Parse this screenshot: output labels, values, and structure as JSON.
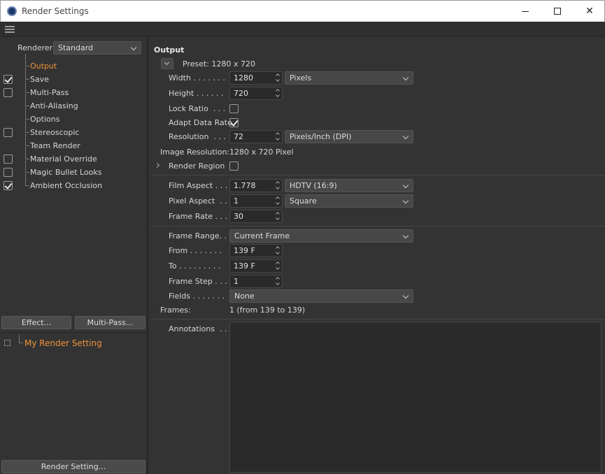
{
  "window": {
    "title": "Render Settings",
    "minimize": "—",
    "close": "✕"
  },
  "left": {
    "renderer_label": "Renderer",
    "renderer_value": "Standard",
    "items": [
      {
        "label": "Output",
        "checkbox": false,
        "checked": false,
        "active": true
      },
      {
        "label": "Save",
        "checkbox": true,
        "checked": true,
        "active": false
      },
      {
        "label": "Multi-Pass",
        "checkbox": true,
        "checked": false,
        "active": false
      },
      {
        "label": "Anti-Aliasing",
        "checkbox": false,
        "checked": false,
        "active": false
      },
      {
        "label": "Options",
        "checkbox": false,
        "checked": false,
        "active": false
      },
      {
        "label": "Stereoscopic",
        "checkbox": true,
        "checked": false,
        "active": false
      },
      {
        "label": "Team Render",
        "checkbox": false,
        "checked": false,
        "active": false
      },
      {
        "label": "Material Override",
        "checkbox": true,
        "checked": false,
        "active": false
      },
      {
        "label": "Magic Bullet Looks",
        "checkbox": true,
        "checked": false,
        "active": false
      },
      {
        "label": "Ambient Occlusion",
        "checkbox": true,
        "checked": true,
        "active": false
      }
    ],
    "effect_button": "Effect...",
    "multipass_button": "Multi-Pass...",
    "render_setting_name": "My Render Setting",
    "render_setting_button": "Render Setting..."
  },
  "output": {
    "section_title": "Output",
    "preset": "Preset: 1280 x 720",
    "width_label": "Width . . . . . . .",
    "width_value": "1280",
    "width_unit": "Pixels",
    "height_label": "Height . . . . . .",
    "height_value": "720",
    "lock_ratio_label": "Lock Ratio  . . .",
    "lock_ratio_checked": false,
    "adapt_label": "Adapt Data Rate",
    "adapt_checked": true,
    "resolution_label": "Resolution  . . .",
    "resolution_value": "72",
    "resolution_unit": "Pixels/Inch (DPI)",
    "image_resolution_label": "Image Resolution:",
    "image_resolution_value": "1280 x 720 Pixel",
    "render_region_label": "Render Region",
    "render_region_checked": false,
    "film_aspect_label": "Film Aspect . . .",
    "film_aspect_value": "1.778",
    "film_aspect_preset": "HDTV (16:9)",
    "pixel_aspect_label": "Pixel Aspect  . .",
    "pixel_aspect_value": "1",
    "pixel_aspect_preset": "Square",
    "frame_rate_label": "Frame Rate . . .",
    "frame_rate_value": "30",
    "frame_range_label": "Frame Range. .",
    "frame_range_value": "Current Frame",
    "from_label": "From . . . . . . .",
    "from_value": "139 F",
    "to_label": "To . . . . . . . . .",
    "to_value": "139 F",
    "frame_step_label": "Frame Step . . .",
    "frame_step_value": "1",
    "fields_label": "Fields . . . . . . .",
    "fields_value": "None",
    "frames_label": "Frames:",
    "frames_value": "1 (from 139 to 139)",
    "annotations_label": "Annotations  . ."
  }
}
